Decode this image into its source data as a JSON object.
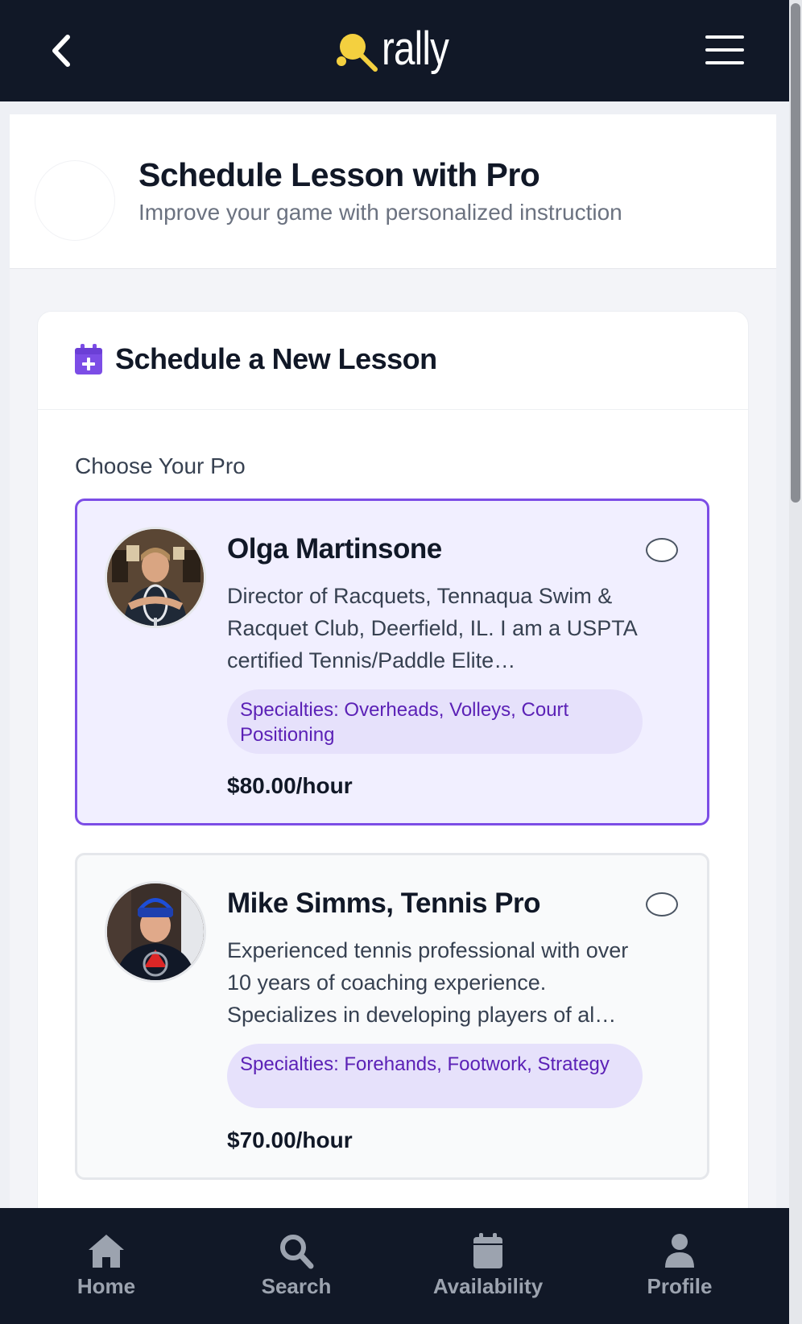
{
  "app": {
    "brand": "rally",
    "accent_color": "#f4d03f",
    "nav_color": "#111827",
    "brand_purple": "#7c4de6"
  },
  "header": {
    "back_icon": "chevron-left-icon",
    "menu_icon": "hamburger-menu-icon"
  },
  "page": {
    "title": "Schedule Lesson with Pro",
    "subtitle": "Improve your game with personalized instruction"
  },
  "lesson": {
    "icon": "calendar-plus-icon",
    "title": "Schedule a New Lesson",
    "choose_label": "Choose Your Pro"
  },
  "pros": [
    {
      "name": "Olga Martinsone",
      "bio": "Director of Racquets, Tennaqua Swim & Racquet Club, Deerfield, IL. I am a USPTA certified Tennis/Paddle Elite…",
      "specialties": "Specialties: Overheads, Volleys, Court Positioning",
      "price": "$80.00/hour",
      "selected": true
    },
    {
      "name": "Mike Simms, Tennis Pro",
      "bio": "Experienced tennis professional with over 10 years of coaching experience. Specializes in developing players of al…",
      "specialties": "Specialties: Forehands, Footwork, Strategy",
      "price": "$70.00/hour",
      "selected": false
    }
  ],
  "bottom_nav": [
    {
      "label": "Home",
      "icon": "home-icon"
    },
    {
      "label": "Search",
      "icon": "search-icon"
    },
    {
      "label": "Availability",
      "icon": "calendar-icon"
    },
    {
      "label": "Profile",
      "icon": "user-icon"
    }
  ]
}
